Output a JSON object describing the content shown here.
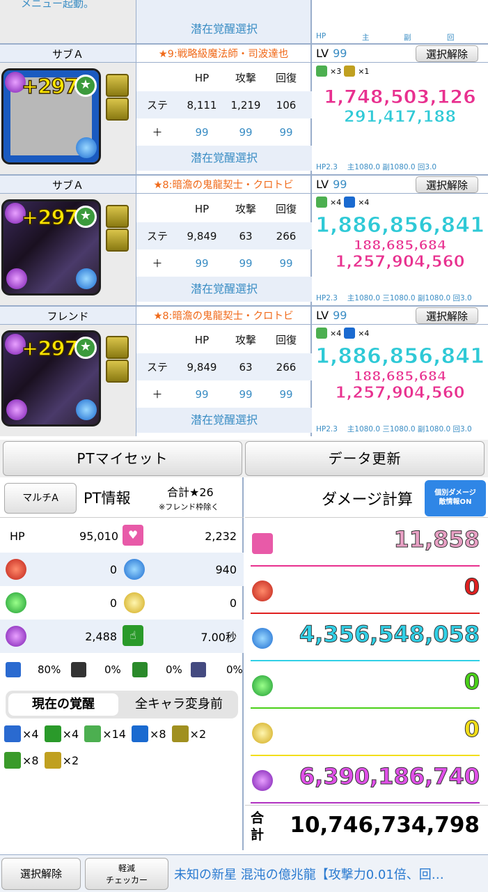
{
  "top": {
    "menu_fragment": "メニュー起動。",
    "latent_label": "潜在覚醒選択",
    "stat_headers": [
      "HP",
      "主",
      "副",
      "回"
    ]
  },
  "slots": [
    {
      "slot_label": "サブＡ",
      "monster_name": "★9:戦略級魔法師・司波達也",
      "lv_label": "LV",
      "lv_value": "99",
      "deselect": "選択解除",
      "plus": "+297",
      "stat_head": [
        "HP",
        "攻撃",
        "回復"
      ],
      "ste_label": "ステ",
      "ste": [
        "8,111",
        "1,219",
        "106"
      ],
      "plus_label": "＋",
      "plus_vals": [
        "99",
        "99",
        "99"
      ],
      "latent": "潜在覚醒選択",
      "awakenings": [
        {
          "icon": "combo-10-icon",
          "count": "×3"
        },
        {
          "icon": "sword-icon",
          "count": "×1"
        }
      ],
      "dmg_main": "1,748,503,126",
      "dmg_main_color": "#e8308f",
      "dmg_lines": [
        {
          "text": "291,417,188",
          "color": "#2ec9d6"
        }
      ],
      "mult": "HP2.3 　主1080.0 副1080.0 回3.0",
      "portrait_style": "blank"
    },
    {
      "slot_label": "サブＡ",
      "monster_name": "★8:暗澹の鬼龍契士・クロトビ",
      "lv_label": "LV",
      "lv_value": "99",
      "deselect": "選択解除",
      "plus": "+297",
      "stat_head": [
        "HP",
        "攻撃",
        "回復"
      ],
      "ste_label": "ステ",
      "ste": [
        "9,849",
        "63",
        "266"
      ],
      "plus_label": "＋",
      "plus_vals": [
        "99",
        "99",
        "99"
      ],
      "latent": "潜在覚醒選択",
      "awakenings": [
        {
          "icon": "combo-10-icon",
          "count": "×4"
        },
        {
          "icon": "magnet-icon",
          "count": "×4"
        }
      ],
      "dmg_main": "1,886,856,841",
      "dmg_main_color": "#2ec9d6",
      "dmg_lines": [
        {
          "text": "188,685,684",
          "color": "#e8308f"
        },
        {
          "text": "1,257,904,560",
          "color": "#e8308f"
        }
      ],
      "mult": "HP2.3 　主1080.0 三1080.0 副1080.0 回3.0",
      "portrait_style": "dark"
    },
    {
      "slot_label": "フレンド",
      "monster_name": "★8:暗澹の鬼龍契士・クロトビ",
      "lv_label": "LV",
      "lv_value": "99",
      "deselect": "選択解除",
      "plus": "+297",
      "stat_head": [
        "HP",
        "攻撃",
        "回復"
      ],
      "ste_label": "ステ",
      "ste": [
        "9,849",
        "63",
        "266"
      ],
      "plus_label": "＋",
      "plus_vals": [
        "99",
        "99",
        "99"
      ],
      "latent": "潜在覚醒選択",
      "awakenings": [
        {
          "icon": "combo-10-icon",
          "count": "×4"
        },
        {
          "icon": "magnet-icon",
          "count": "×4"
        }
      ],
      "dmg_main": "1,886,856,841",
      "dmg_main_color": "#2ec9d6",
      "dmg_lines": [
        {
          "text": "188,685,684",
          "color": "#e8308f"
        },
        {
          "text": "1,257,904,560",
          "color": "#e8308f"
        }
      ],
      "mult": "HP2.3 　主1080.0 三1080.0 副1080.0 回3.0",
      "portrait_style": "dark"
    }
  ],
  "buttons": {
    "pt_myset": "PTマイセット",
    "data_update": "データ更新"
  },
  "info": {
    "multi_btn": "マルチA",
    "pt_info": "PT情報",
    "total_star": "合計★26",
    "friend_note": "※フレンド枠除く",
    "hp_label": "HP",
    "hp_value": "95,010",
    "heart_value": "2,232",
    "fire_value": "0",
    "water_value": "940",
    "wood_value": "0",
    "light_value": "0",
    "dark_value": "2,488",
    "time_value": "7.00秒",
    "resist": [
      "80%",
      "0%",
      "0%",
      "0%"
    ],
    "tab_current": "現在の覚醒",
    "tab_all": "全キャラ変身前",
    "awk_row1": [
      {
        "icon": "skill-boost-icon",
        "count": "×4"
      },
      {
        "icon": "finger-icon",
        "count": "×4"
      },
      {
        "icon": "combo-10-icon",
        "count": "×14"
      },
      {
        "icon": "magnet-icon",
        "count": "×8"
      },
      {
        "icon": "orb-jammer-icon",
        "count": "×2"
      }
    ],
    "awk_row2": [
      {
        "icon": "bind-resist-icon",
        "count": "×8"
      },
      {
        "icon": "sword-icon",
        "count": "×2"
      }
    ]
  },
  "damage": {
    "title": "ダメージ計算",
    "toggle": "個別ダメージ\n敵情報ON",
    "rows": [
      {
        "attr": "heart",
        "value": "11,858",
        "color": "#e8a0c4",
        "line": "#e8308f"
      },
      {
        "attr": "fire",
        "value": "0",
        "color": "#e02020",
        "line": "#e02020"
      },
      {
        "attr": "water",
        "value": "4,356,548,058",
        "color": "#31d0e6",
        "line": "#31d0e6"
      },
      {
        "attr": "wood",
        "value": "0",
        "color": "#4ad018",
        "line": "#4ad018"
      },
      {
        "attr": "light",
        "value": "0",
        "color": "#f2de1a",
        "line": "#f2de1a"
      },
      {
        "attr": "dark",
        "value": "6,390,186,740",
        "color": "#e050e8",
        "line": "#b030c0"
      }
    ],
    "total_label": "合計",
    "total_value": "10,746,734,798"
  },
  "footer": {
    "deselect": "選択解除",
    "checker": "軽減\nチェッカー",
    "dungeon": "未知の新星 混沌の億兆龍【攻撃力0.01倍、回…"
  }
}
